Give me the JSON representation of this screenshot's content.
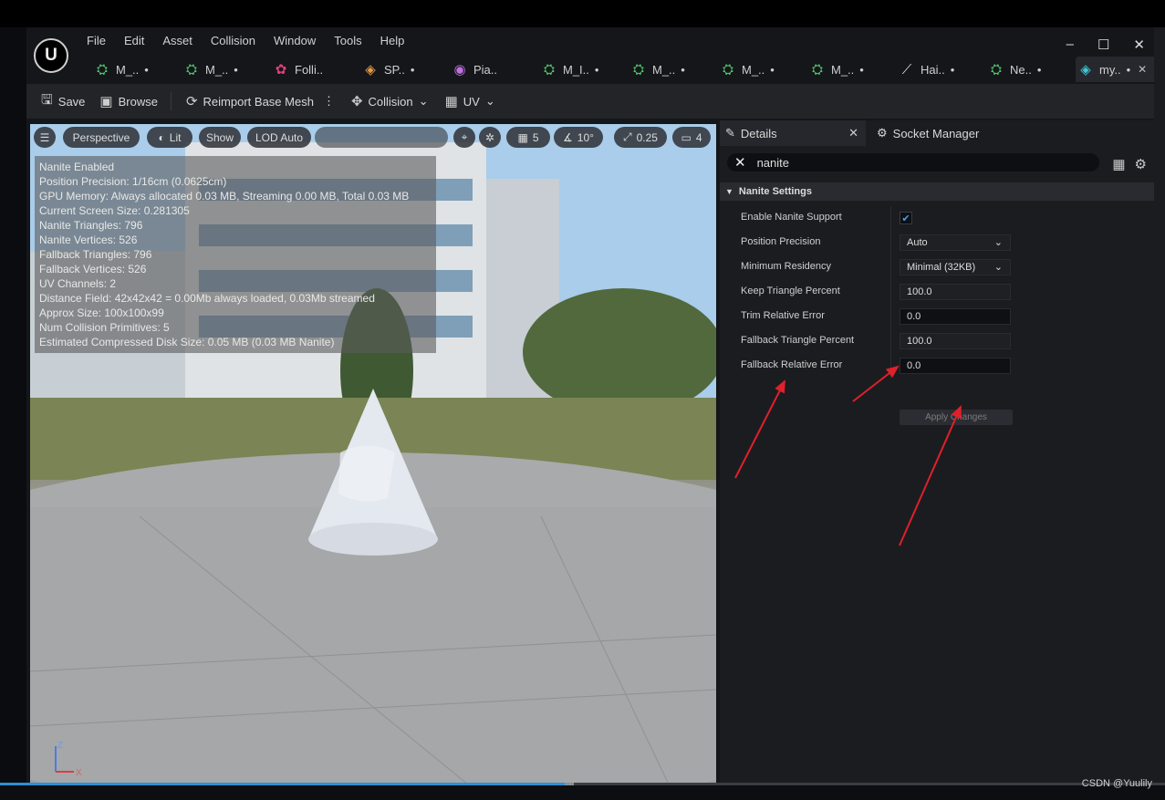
{
  "app": {
    "menu": [
      "File",
      "Edit",
      "Asset",
      "Collision",
      "Window",
      "Tools",
      "Help"
    ],
    "window_controls": {
      "minimize": "–",
      "maximize": "☐",
      "close": "✕"
    }
  },
  "tabs": [
    {
      "label": "M_..",
      "icon": "material-icon",
      "dot": "•"
    },
    {
      "label": "M_..",
      "icon": "material-icon",
      "dot": "•"
    },
    {
      "label": "Folli..",
      "icon": "foliage-icon",
      "dot": ""
    },
    {
      "label": "SP..",
      "icon": "static-mesh-icon",
      "dot": "•"
    },
    {
      "label": "Pia..",
      "icon": "particle-icon",
      "dot": ""
    },
    {
      "label": "M_I..",
      "icon": "material-icon",
      "dot": "•"
    },
    {
      "label": "M_..",
      "icon": "material-icon",
      "dot": "•"
    },
    {
      "label": "M_..",
      "icon": "material-icon",
      "dot": "•"
    },
    {
      "label": "M_..",
      "icon": "material-icon",
      "dot": "•"
    },
    {
      "label": "Hai..",
      "icon": "groom-icon",
      "dot": "•"
    },
    {
      "label": "Ne..",
      "icon": "niagara-icon",
      "dot": "•"
    },
    {
      "label": "my..",
      "icon": "static-mesh-icon",
      "dot": "•",
      "close": "✕",
      "active": true
    }
  ],
  "toolbar": {
    "save": "Save",
    "browse": "Browse",
    "reimport": "Reimport Base Mesh",
    "more": "⋮",
    "collision": "Collision",
    "uv": "UV"
  },
  "viewport": {
    "perspective": "Perspective",
    "lit": "Lit",
    "show": "Show",
    "lod": "LOD Auto",
    "grid_snap": "5",
    "rotation_snap": "10°",
    "scale_snap": "0.25",
    "camera_speed": "4",
    "stats": [
      "Nanite Enabled",
      "Position Precision: 1/16cm (0.0625cm)",
      "GPU Memory: Always allocated 0.03 MB, Streaming 0.00 MB, Total 0.03 MB",
      "Current Screen Size: 0.281305",
      "Nanite Triangles: 796",
      "Nanite Vertices: 526",
      "Fallback Triangles: 796",
      "Fallback Vertices: 526",
      "UV Channels: 2",
      "Distance Field: 42x42x42 = 0.00Mb always loaded, 0.03Mb streamed",
      "Approx Size: 100x100x99",
      "Num Collision Primitives: 5",
      "Estimated Compressed Disk Size: 0.05 MB (0.03 MB Nanite)"
    ],
    "axis": {
      "z": "Z",
      "x": "X"
    }
  },
  "details": {
    "tab_details": "Details",
    "tab_socket": "Socket Manager",
    "search_value": "nanite",
    "section": "Nanite Settings",
    "props": [
      {
        "label": "Enable Nanite Support",
        "type": "check",
        "value": "✔"
      },
      {
        "label": "Position Precision",
        "type": "dropdown",
        "value": "Auto"
      },
      {
        "label": "Minimum Residency",
        "type": "dropdown",
        "value": "Minimal (32KB)"
      },
      {
        "label": "Keep Triangle Percent",
        "type": "num",
        "value": "100.0"
      },
      {
        "label": "Trim Relative Error",
        "type": "text",
        "value": "0.0"
      },
      {
        "label": "Fallback Triangle Percent",
        "type": "num",
        "value": "100.0"
      },
      {
        "label": "Fallback Relative Error",
        "type": "text",
        "value": "0.0"
      }
    ],
    "apply": "Apply Changes"
  },
  "watermark": "CSDN @Yuulily",
  "video": {
    "progress": 0.485,
    "buffered": 0.493
  },
  "colors": {
    "accent": "#2e8fd6",
    "annotation_arrow": "#e0202a"
  }
}
